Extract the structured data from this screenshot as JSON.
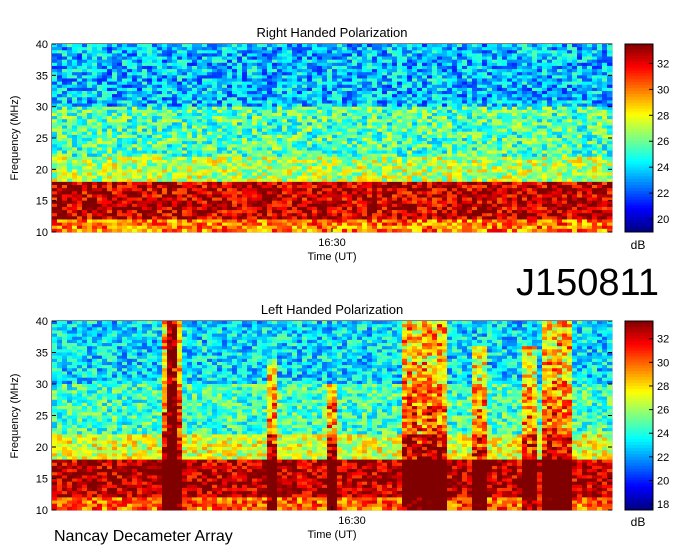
{
  "figure_id": "J150811",
  "footer": "Nancay Decameter Array",
  "colors": {
    "colormap": "jet",
    "colormap_stops": [
      "#00008f",
      "#0000ff",
      "#00ffff",
      "#ffff00",
      "#ff0000",
      "#800000"
    ]
  },
  "chart_data": [
    {
      "type": "heatmap",
      "title": "Right Handed Polarization",
      "xlabel": "Time (UT)",
      "ylabel": "Frequency (MHz)",
      "x_ticks": [
        "16:30"
      ],
      "y_ticks": [
        10,
        15,
        20,
        25,
        30,
        35,
        40
      ],
      "ylim": [
        10,
        40
      ],
      "colorbar": {
        "label": "dB",
        "ticks": [
          20,
          22,
          24,
          26,
          28,
          30,
          32
        ],
        "range": [
          19,
          33.5
        ]
      },
      "intensity_profile_by_band": [
        {
          "freq_range_mhz": [
            10,
            12
          ],
          "level_db": 30
        },
        {
          "freq_range_mhz": [
            12,
            18
          ],
          "level_db": 32.5
        },
        {
          "freq_range_mhz": [
            18,
            22
          ],
          "level_db": 27
        },
        {
          "freq_range_mhz": [
            22,
            30
          ],
          "level_db": 25.5
        },
        {
          "freq_range_mhz": [
            30,
            40
          ],
          "level_db": 23.5
        }
      ]
    },
    {
      "type": "heatmap",
      "title": "Left Handed Polarization",
      "xlabel": "Time (UT)",
      "ylabel": "Frequency (MHz)",
      "x_ticks": [
        "16:30"
      ],
      "y_ticks": [
        10,
        15,
        20,
        25,
        30,
        35,
        40
      ],
      "ylim": [
        10,
        40
      ],
      "colorbar": {
        "label": "dB",
        "ticks": [
          18,
          20,
          22,
          24,
          26,
          28,
          30,
          32
        ],
        "range": [
          17.5,
          33.5
        ]
      },
      "intensity_profile_by_band": [
        {
          "freq_range_mhz": [
            10,
            12
          ],
          "level_db": 30
        },
        {
          "freq_range_mhz": [
            12,
            18
          ],
          "level_db": 32.5
        },
        {
          "freq_range_mhz": [
            18,
            22
          ],
          "level_db": 27
        },
        {
          "freq_range_mhz": [
            22,
            30
          ],
          "level_db": 24.5
        },
        {
          "freq_range_mhz": [
            30,
            40
          ],
          "level_db": 23
        }
      ]
    }
  ]
}
